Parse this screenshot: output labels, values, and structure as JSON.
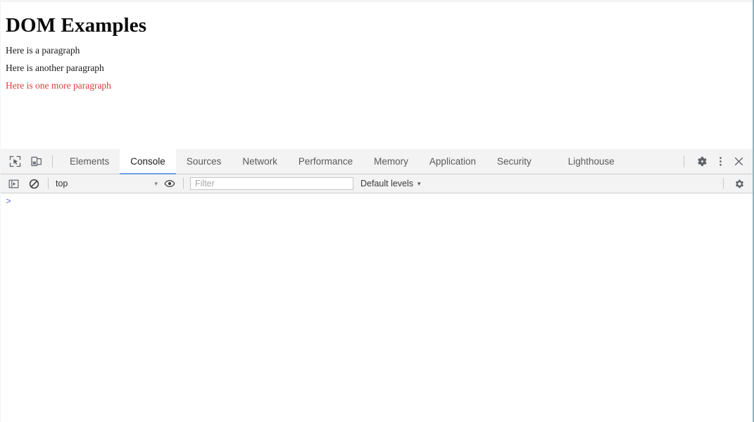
{
  "page": {
    "title": "DOM Examples",
    "paragraphs": [
      {
        "text": "Here is a paragraph",
        "color": "#1a1a1a"
      },
      {
        "text": "Here is another paragraph",
        "color": "#1a1a1a"
      },
      {
        "text": "Here is one more paragraph",
        "color": "#e03c3c"
      }
    ]
  },
  "devtools": {
    "icons": {
      "inspect": "inspect-element-icon",
      "device": "device-toolbar-icon",
      "settings": "gear-icon",
      "more": "kebab-menu-icon",
      "close": "close-icon",
      "sidebar_toggle": "console-sidebar-icon",
      "clear_console": "clear-console-icon",
      "eye": "eye-icon",
      "filter_settings": "gear-icon"
    },
    "tabs": [
      {
        "label": "Elements",
        "active": false
      },
      {
        "label": "Console",
        "active": true
      },
      {
        "label": "Sources",
        "active": false
      },
      {
        "label": "Network",
        "active": false
      },
      {
        "label": "Performance",
        "active": false
      },
      {
        "label": "Memory",
        "active": false
      },
      {
        "label": "Application",
        "active": false
      },
      {
        "label": "Security",
        "active": false
      },
      {
        "label": "Lighthouse",
        "active": false
      }
    ],
    "console": {
      "context": "top",
      "context_caret": "▾",
      "filter_placeholder": "Filter",
      "filter_value": "",
      "levels": "Default levels",
      "levels_caret": "▾",
      "prompt": ">",
      "input_value": ""
    },
    "colors": {
      "active_tab_underline": "#6ba0e8",
      "toolbar_background": "#f3f3f3",
      "prompt": "#6a6ad8"
    }
  }
}
